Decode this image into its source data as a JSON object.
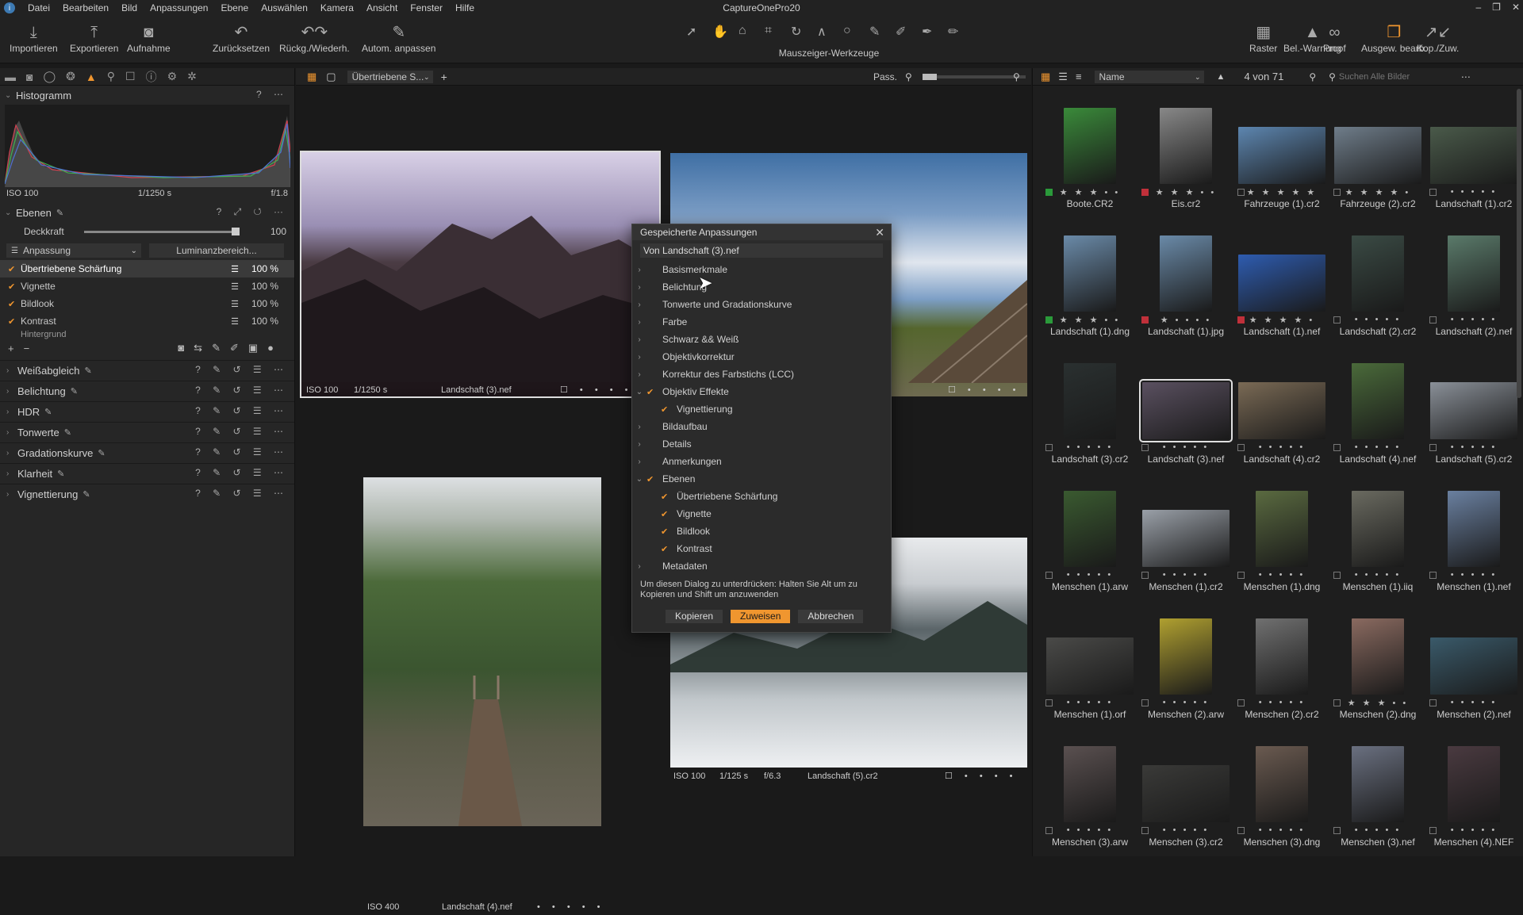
{
  "app": {
    "title": "CaptureOnePro20"
  },
  "menu": [
    "Datei",
    "Bearbeiten",
    "Bild",
    "Anpassungen",
    "Ebene",
    "Auswählen",
    "Kamera",
    "Ansicht",
    "Fenster",
    "Hilfe"
  ],
  "toolbar": {
    "left": [
      {
        "label": "Importieren",
        "icon": "import-icon"
      },
      {
        "label": "Exportieren",
        "icon": "export-icon"
      },
      {
        "label": "Aufnahme",
        "icon": "camera-icon"
      },
      {
        "label": "Zurücksetzen",
        "icon": "reset-icon"
      },
      {
        "label": "Rückg./Wiederh.",
        "icon": "undo-redo-icon"
      },
      {
        "label": "Autom. anpassen",
        "icon": "auto-adjust-icon"
      }
    ],
    "cursor_tools_label": "Mauszeiger-Werkzeuge",
    "right": [
      {
        "label": "Raster",
        "icon": "grid-icon"
      },
      {
        "label": "Bel.-Warnung",
        "icon": "exposure-warning-icon"
      },
      {
        "label": "Proof",
        "icon": "proof-icon"
      },
      {
        "label": "Ausgew. bearb.",
        "icon": "edit-selected-icon"
      },
      {
        "label": "Kop./Zuw.",
        "icon": "copy-apply-icon"
      }
    ]
  },
  "left": {
    "histogram": {
      "title": "Histogramm",
      "iso": "ISO 100",
      "shutter": "1/1250 s",
      "aperture": "f/1.8"
    },
    "layers": {
      "title": "Ebenen",
      "opacity_label": "Deckkraft",
      "opacity_value": "100",
      "opacity_fraction": 1.0,
      "mode": "Anpassung",
      "luma_button": "Luminanzbereich...",
      "items": [
        {
          "name": "Übertriebene Schärfung",
          "pct": "100 %"
        },
        {
          "name": "Vignette",
          "pct": "100 %"
        },
        {
          "name": "Bildlook",
          "pct": "100 %"
        },
        {
          "name": "Kontrast",
          "pct": "100 %"
        },
        {
          "name": "Hintergrund",
          "pct": ""
        }
      ]
    },
    "adjustments": [
      "Weißabgleich",
      "Belichtung",
      "HDR",
      "Tonwerte",
      "Gradationskurve",
      "Klarheit",
      "Vignettierung"
    ]
  },
  "viewer": {
    "preset": "Übertriebene S...",
    "fit": "Pass.",
    "images": [
      {
        "iso": "ISO 100",
        "shutter": "1/1250 s",
        "aperture": "",
        "name": "Landschaft (3).nef"
      },
      {
        "iso": "",
        "shutter": "",
        "aperture": "",
        "name": ""
      },
      {
        "iso": "ISO 400",
        "shutter": "",
        "aperture": "",
        "name": "Landschaft (4).nef"
      },
      {
        "iso": "ISO 100",
        "shutter": "1/125 s",
        "aperture": "f/6.3",
        "name": "Landschaft (5).cr2"
      }
    ]
  },
  "browser": {
    "sort": "Name",
    "count": "4 von 71",
    "search_placeholder": "Suchen Alle Bilder",
    "thumbs": [
      {
        "name": "Boote.CR2",
        "stars": "★ ★ ★ • •",
        "color": "#3a8a3a",
        "label": "#2a9a3a"
      },
      {
        "name": "Eis.cr2",
        "stars": "★ ★ ★ • •",
        "color": "#888",
        "label": "#c0303a"
      },
      {
        "name": "Fahrzeuge (1).cr2",
        "stars": "★ ★ ★ ★ ★",
        "color": "#5d86b0",
        "label": ""
      },
      {
        "name": "Fahrzeuge (2).cr2",
        "stars": "★ ★ ★ ★ •",
        "color": "#6f7d8a",
        "label": ""
      },
      {
        "name": "Landschaft (1).cr2",
        "stars": "• • • • •",
        "color": "#4a5a4a",
        "label": ""
      },
      {
        "name": "Landschaft (1).dng",
        "stars": "★ ★ ★ • •",
        "color": "#6a8aa8",
        "label": "#2a9a3a"
      },
      {
        "name": "Landschaft (1).jpg",
        "stars": "★ • • • •",
        "color": "#6a8aa8",
        "label": "#c0303a"
      },
      {
        "name": "Landschaft (1).nef",
        "stars": "★ ★ ★ ★ •",
        "color": "#2e5cb0",
        "label": "#c0303a"
      },
      {
        "name": "Landschaft (2).cr2",
        "stars": "• • • • •",
        "color": "#3a4a44",
        "label": ""
      },
      {
        "name": "Landschaft (2).nef",
        "stars": "• • • • •",
        "color": "#5a7a6a",
        "label": ""
      },
      {
        "name": "Landschaft (3).cr2",
        "stars": "• • • • •",
        "color": "#2a3030",
        "label": ""
      },
      {
        "name": "Landschaft (3).nef",
        "stars": "• • • • •",
        "color": "#5a5060",
        "label": ""
      },
      {
        "name": "Landschaft (4).cr2",
        "stars": "• • • • •",
        "color": "#7a6a55",
        "label": ""
      },
      {
        "name": "Landschaft (4).nef",
        "stars": "• • • • •",
        "color": "#4a6a3a",
        "label": ""
      },
      {
        "name": "Landschaft (5).cr2",
        "stars": "• • • • •",
        "color": "#8a9098",
        "label": ""
      },
      {
        "name": "Menschen (1).arw",
        "stars": "• • • • •",
        "color": "#3a5a30",
        "label": ""
      },
      {
        "name": "Menschen (1).cr2",
        "stars": "• • • • •",
        "color": "#9aa0a8",
        "label": ""
      },
      {
        "name": "Menschen (1).dng",
        "stars": "• • • • •",
        "color": "#5a6a40",
        "label": ""
      },
      {
        "name": "Menschen (1).iiq",
        "stars": "• • • • •",
        "color": "#6a6a60",
        "label": ""
      },
      {
        "name": "Menschen (1).nef",
        "stars": "• • • • •",
        "color": "#6a80a0",
        "label": ""
      },
      {
        "name": "Menschen (1).orf",
        "stars": "• • • • •",
        "color": "#4a4a48",
        "label": ""
      },
      {
        "name": "Menschen (2).arw",
        "stars": "• • • • •",
        "color": "#b0a030",
        "label": ""
      },
      {
        "name": "Menschen (2).cr2",
        "stars": "• • • • •",
        "color": "#707070",
        "label": ""
      },
      {
        "name": "Menschen (2).dng",
        "stars": "★ ★ ★ • •",
        "color": "#8a6a60",
        "label": ""
      },
      {
        "name": "Menschen (2).nef",
        "stars": "• • • • •",
        "color": "#3a5a6a",
        "label": ""
      },
      {
        "name": "Menschen (3).arw",
        "stars": "• • • • •",
        "color": "#5a5050",
        "label": ""
      },
      {
        "name": "Menschen (3).cr2",
        "stars": "• • • • •",
        "color": "#3a3a38",
        "label": ""
      },
      {
        "name": "Menschen (3).dng",
        "stars": "• • • • •",
        "color": "#6a5a50",
        "label": ""
      },
      {
        "name": "Menschen (3).nef",
        "stars": "• • • • •",
        "color": "#6a7080",
        "label": ""
      },
      {
        "name": "Menschen (4).NEF",
        "stars": "• • • • •",
        "color": "#4a3a40",
        "label": ""
      }
    ]
  },
  "dialog": {
    "title": "Gespeicherte Anpassungen",
    "source": "Von Landschaft (3).nef",
    "items": [
      {
        "label": "Basismerkmale",
        "level": 0,
        "expand": "›",
        "checked": false
      },
      {
        "label": "Belichtung",
        "level": 0,
        "expand": "›",
        "checked": false
      },
      {
        "label": "Tonwerte und Gradationskurve",
        "level": 0,
        "expand": "›",
        "checked": false
      },
      {
        "label": "Farbe",
        "level": 0,
        "expand": "›",
        "checked": false
      },
      {
        "label": "Schwarz && Weiß",
        "level": 0,
        "expand": "›",
        "checked": false
      },
      {
        "label": "Objektivkorrektur",
        "level": 0,
        "expand": "›",
        "checked": false
      },
      {
        "label": "Korrektur des Farbstichs (LCC)",
        "level": 0,
        "expand": "›",
        "checked": false
      },
      {
        "label": "Objektiv Effekte",
        "level": 0,
        "expand": "⌄",
        "checked": true
      },
      {
        "label": "Vignettierung",
        "level": 1,
        "expand": "",
        "checked": true
      },
      {
        "label": "Bildaufbau",
        "level": 0,
        "expand": "›",
        "checked": false
      },
      {
        "label": "Details",
        "level": 0,
        "expand": "›",
        "checked": false
      },
      {
        "label": "Anmerkungen",
        "level": 0,
        "expand": "›",
        "checked": false
      },
      {
        "label": "Ebenen",
        "level": 0,
        "expand": "⌄",
        "checked": true
      },
      {
        "label": "Übertriebene Schärfung",
        "level": 1,
        "expand": "",
        "checked": true
      },
      {
        "label": "Vignette",
        "level": 1,
        "expand": "",
        "checked": true
      },
      {
        "label": "Bildlook",
        "level": 1,
        "expand": "",
        "checked": true
      },
      {
        "label": "Kontrast",
        "level": 1,
        "expand": "",
        "checked": true
      },
      {
        "label": "Metadaten",
        "level": 0,
        "expand": "›",
        "checked": false
      }
    ],
    "hint": "Um diesen Dialog zu unterdrücken: Halten Sie Alt um zu Kopieren und Shift um anzuwenden",
    "copy": "Kopieren",
    "apply": "Zuweisen",
    "cancel": "Abbrechen"
  }
}
